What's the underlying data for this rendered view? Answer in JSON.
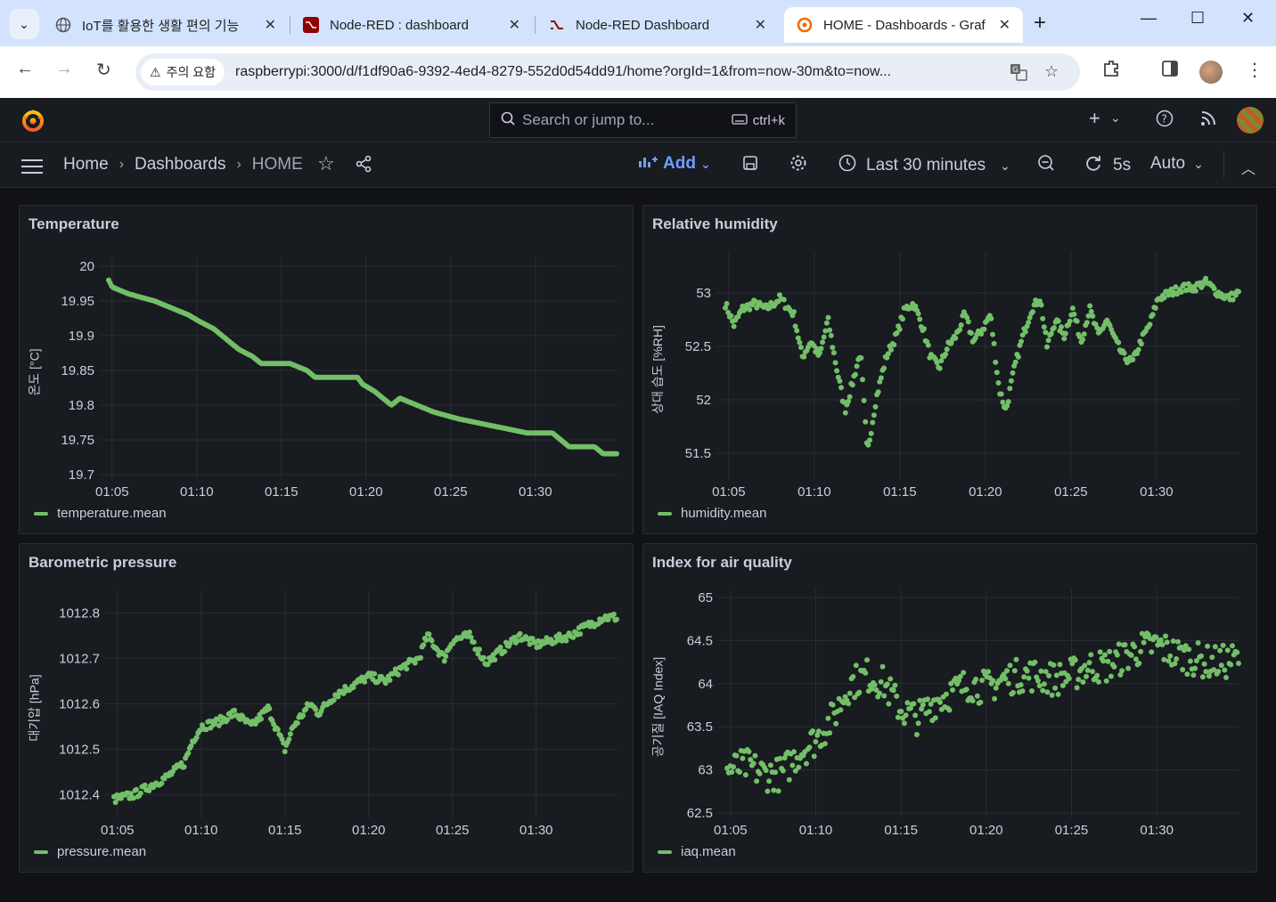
{
  "browser": {
    "tabs": [
      {
        "title": "IoT를 활용한 생활 편의 기능",
        "close": "✕"
      },
      {
        "title": "Node-RED : dashboard",
        "close": "✕"
      },
      {
        "title": "Node-RED Dashboard",
        "close": "✕"
      },
      {
        "title": "HOME - Dashboards - Graf",
        "close": "✕"
      }
    ],
    "warning_label": "주의 요함",
    "url": "raspberrypi:3000/d/f1df90a6-9392-4ed4-8279-552d0d54dd91/home?orgId=1&from=now-30m&to=now..."
  },
  "grafana": {
    "search_placeholder": "Search or jump to...",
    "search_shortcut": "ctrl+k",
    "breadcrumb": [
      "Home",
      "Dashboards",
      "HOME"
    ],
    "add_label": "Add",
    "time_range": "Last 30 minutes",
    "refresh_interval": "5s",
    "refresh_mode": "Auto",
    "series_color": "#73bf69"
  },
  "chart_data": [
    {
      "type": "scatter",
      "title": "Temperature",
      "ylabel": "온도 [°C]",
      "legend": "temperature.mean",
      "x_ticks": [
        "01:05",
        "01:10",
        "01:15",
        "01:20",
        "01:25",
        "01:30"
      ],
      "y_ticks": [
        19.7,
        19.75,
        19.8,
        19.85,
        19.9,
        19.95,
        20
      ],
      "ylim": [
        19.7,
        20
      ],
      "x_range_min": [
        4.8,
        34.8
      ],
      "trend": [
        [
          4.8,
          19.98
        ],
        [
          5,
          19.97
        ],
        [
          6,
          19.96
        ],
        [
          7.5,
          19.95
        ],
        [
          8.5,
          19.94
        ],
        [
          9.5,
          19.93
        ],
        [
          10.2,
          19.92
        ],
        [
          11,
          19.91
        ],
        [
          11.5,
          19.9
        ],
        [
          12,
          19.89
        ],
        [
          12.5,
          19.88
        ],
        [
          13.3,
          19.87
        ],
        [
          13.8,
          19.86
        ],
        [
          15.5,
          19.86
        ],
        [
          16.5,
          19.85
        ],
        [
          17,
          19.84
        ],
        [
          19.5,
          19.84
        ],
        [
          19.8,
          19.83
        ],
        [
          20.5,
          19.82
        ],
        [
          21,
          19.81
        ],
        [
          21.5,
          19.8
        ],
        [
          22,
          19.81
        ],
        [
          23,
          19.8
        ],
        [
          24,
          19.79
        ],
        [
          25.5,
          19.78
        ],
        [
          27.5,
          19.77
        ],
        [
          29.5,
          19.76
        ],
        [
          31,
          19.76
        ],
        [
          31.5,
          19.75
        ],
        [
          32,
          19.74
        ],
        [
          33.5,
          19.74
        ],
        [
          34,
          19.73
        ],
        [
          34.8,
          19.73
        ]
      ],
      "style": "steps"
    },
    {
      "type": "scatter",
      "title": "Relative humidity",
      "ylabel": "상대 습도 [%RH]",
      "legend": "humidity.mean",
      "x_ticks": [
        "01:05",
        "01:10",
        "01:15",
        "01:20",
        "01:25",
        "01:30"
      ],
      "y_ticks": [
        51.5,
        52,
        52.5,
        53
      ],
      "ylim": [
        51.3,
        53.3
      ],
      "x_range_min": [
        4.8,
        34.8
      ],
      "trend": [
        [
          4.8,
          52.9
        ],
        [
          5.3,
          52.7
        ],
        [
          5.8,
          52.85
        ],
        [
          6.5,
          52.9
        ],
        [
          7.2,
          52.85
        ],
        [
          8,
          52.95
        ],
        [
          8.8,
          52.8
        ],
        [
          9.3,
          52.4
        ],
        [
          9.8,
          52.55
        ],
        [
          10.3,
          52.4
        ],
        [
          10.8,
          52.75
        ],
        [
          11.3,
          52.3
        ],
        [
          11.8,
          51.9
        ],
        [
          12.3,
          52.2
        ],
        [
          12.7,
          52.45
        ],
        [
          13.1,
          51.5
        ],
        [
          13.6,
          52.0
        ],
        [
          14.2,
          52.4
        ],
        [
          14.8,
          52.6
        ],
        [
          15.3,
          52.85
        ],
        [
          15.8,
          52.9
        ],
        [
          16.3,
          52.7
        ],
        [
          16.8,
          52.4
        ],
        [
          17.3,
          52.3
        ],
        [
          17.8,
          52.5
        ],
        [
          18.3,
          52.6
        ],
        [
          18.8,
          52.8
        ],
        [
          19.3,
          52.55
        ],
        [
          19.8,
          52.65
        ],
        [
          20.3,
          52.8
        ],
        [
          20.8,
          52.1
        ],
        [
          21.2,
          51.9
        ],
        [
          21.7,
          52.3
        ],
        [
          22.2,
          52.6
        ],
        [
          22.7,
          52.85
        ],
        [
          23.2,
          52.95
        ],
        [
          23.6,
          52.5
        ],
        [
          24.1,
          52.75
        ],
        [
          24.6,
          52.6
        ],
        [
          25.1,
          52.85
        ],
        [
          25.6,
          52.55
        ],
        [
          26.1,
          52.85
        ],
        [
          26.6,
          52.6
        ],
        [
          27.1,
          52.75
        ],
        [
          27.6,
          52.55
        ],
        [
          28.1,
          52.4
        ],
        [
          28.6,
          52.35
        ],
        [
          29.1,
          52.55
        ],
        [
          29.6,
          52.7
        ],
        [
          30.1,
          52.95
        ],
        [
          30.8,
          53.0
        ],
        [
          31.5,
          53.05
        ],
        [
          32.2,
          53.05
        ],
        [
          32.9,
          53.1
        ],
        [
          33.6,
          53.0
        ],
        [
          34.2,
          52.95
        ],
        [
          34.8,
          53.0
        ]
      ],
      "style": "noisy"
    },
    {
      "type": "scatter",
      "title": "Barometric pressure",
      "ylabel": "대기압 [hPa]",
      "legend": "pressure.mean",
      "x_ticks": [
        "01:05",
        "01:10",
        "01:15",
        "01:20",
        "01:25",
        "01:30"
      ],
      "y_ticks": [
        1012.4,
        1012.5,
        1012.6,
        1012.7,
        1012.8
      ],
      "ylim": [
        1012.36,
        1012.83
      ],
      "x_range_min": [
        4.8,
        34.8
      ],
      "trend": [
        [
          4.8,
          1012.39
        ],
        [
          6,
          1012.4
        ],
        [
          7,
          1012.42
        ],
        [
          8,
          1012.44
        ],
        [
          9,
          1012.47
        ],
        [
          9.5,
          1012.52
        ],
        [
          10,
          1012.55
        ],
        [
          11,
          1012.56
        ],
        [
          12,
          1012.58
        ],
        [
          13,
          1012.55
        ],
        [
          14,
          1012.59
        ],
        [
          15,
          1012.5
        ],
        [
          15.5,
          1012.55
        ],
        [
          16.5,
          1012.6
        ],
        [
          17,
          1012.58
        ],
        [
          18,
          1012.62
        ],
        [
          19,
          1012.64
        ],
        [
          20,
          1012.66
        ],
        [
          21,
          1012.65
        ],
        [
          22,
          1012.68
        ],
        [
          23,
          1012.7
        ],
        [
          23.5,
          1012.75
        ],
        [
          24.5,
          1012.7
        ],
        [
          25,
          1012.74
        ],
        [
          26,
          1012.75
        ],
        [
          27,
          1012.69
        ],
        [
          28,
          1012.72
        ],
        [
          29,
          1012.75
        ],
        [
          30,
          1012.73
        ],
        [
          31,
          1012.74
        ],
        [
          32,
          1012.75
        ],
        [
          33,
          1012.77
        ],
        [
          34,
          1012.79
        ],
        [
          34.8,
          1012.79
        ]
      ],
      "style": "noisy_small"
    },
    {
      "type": "scatter",
      "title": "Index for air quality",
      "ylabel": "공기질 [IAQ Index]",
      "legend": "iaq.mean",
      "x_ticks": [
        "01:05",
        "01:10",
        "01:15",
        "01:20",
        "01:25",
        "01:30"
      ],
      "y_ticks": [
        62.5,
        63,
        63.5,
        64,
        64.5,
        65
      ],
      "ylim": [
        62.5,
        65
      ],
      "x_range_min": [
        4.8,
        34.8
      ],
      "trend": [
        [
          4.8,
          63.0
        ],
        [
          6,
          63.05
        ],
        [
          7,
          62.95
        ],
        [
          8,
          62.95
        ],
        [
          9,
          63.2
        ],
        [
          10,
          63.35
        ],
        [
          11,
          63.6
        ],
        [
          12,
          64.0
        ],
        [
          13,
          64.1
        ],
        [
          14,
          64.0
        ],
        [
          15,
          63.7
        ],
        [
          16,
          63.6
        ],
        [
          17,
          63.8
        ],
        [
          18,
          63.9
        ],
        [
          19,
          64.0
        ],
        [
          20,
          63.95
        ],
        [
          21,
          64.05
        ],
        [
          22,
          64.1
        ],
        [
          23,
          64.1
        ],
        [
          24,
          64.05
        ],
        [
          25,
          64.1
        ],
        [
          26,
          64.2
        ],
        [
          27,
          64.2
        ],
        [
          28,
          64.3
        ],
        [
          29,
          64.4
        ],
        [
          30,
          64.45
        ],
        [
          31,
          64.35
        ],
        [
          32,
          64.3
        ],
        [
          33,
          64.25
        ],
        [
          34,
          64.25
        ],
        [
          34.8,
          64.3
        ]
      ],
      "style": "scatter"
    }
  ]
}
